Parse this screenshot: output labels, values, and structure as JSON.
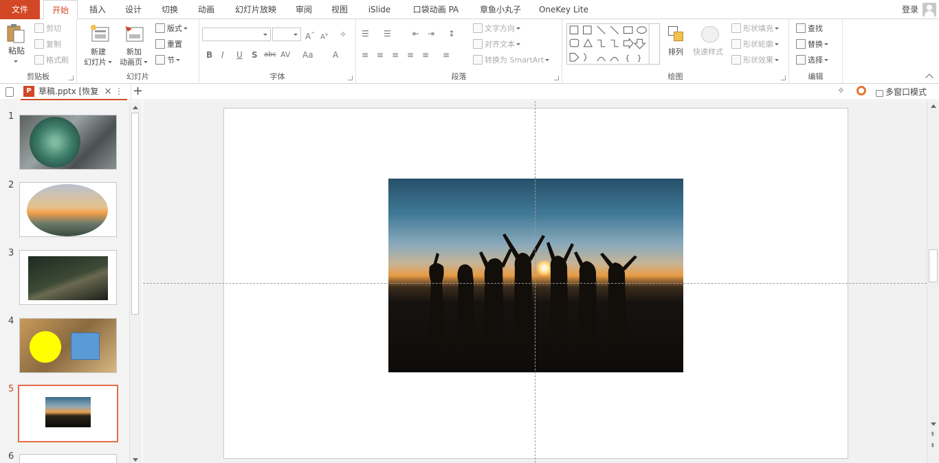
{
  "menu": {
    "file": "文件",
    "tabs": [
      "开始",
      "插入",
      "设计",
      "切换",
      "动画",
      "幻灯片放映",
      "审阅",
      "视图",
      "iSlide",
      "口袋动画 PA",
      "章鱼小丸子",
      "OneKey Lite"
    ],
    "login": "登录"
  },
  "ribbon": {
    "clipboard": {
      "label": "剪贴板",
      "paste": "粘贴",
      "cut": "剪切",
      "copy": "复制",
      "format_painter": "格式刷"
    },
    "slides": {
      "label": "幻灯片",
      "new_slide_1": "新建",
      "new_slide_2": "幻灯片",
      "new_anim_1": "新加",
      "new_anim_2": "动画页",
      "layout": "版式",
      "reset": "重置",
      "section": "节"
    },
    "font": {
      "label": "字体",
      "bold": "B",
      "italic": "I",
      "underline": "U",
      "shadow": "S",
      "strike": "abc",
      "spacing": "AV",
      "case": "Aa",
      "color": "A"
    },
    "paragraph": {
      "label": "段落",
      "text_direction": "文字方向",
      "align_text": "对齐文本",
      "smartart": "转换为 SmartArt"
    },
    "drawing": {
      "label": "绘图",
      "arrange": "排列",
      "quick_styles": "快速样式",
      "shape_fill": "形状填充",
      "shape_outline": "形状轮廓",
      "shape_effects": "形状效果"
    },
    "editing": {
      "label": "编辑",
      "find": "查找",
      "replace": "替换",
      "select": "选择"
    }
  },
  "tabstrip": {
    "doc_title": "草稿.pptx [恢复",
    "multi_window": "多窗口模式",
    "add": "+"
  },
  "thumbs": {
    "numbers": [
      "1",
      "2",
      "3",
      "4",
      "5",
      "6"
    ],
    "selected": "5"
  },
  "colors": {
    "accent": "#d24726",
    "selected_border": "#e46c4a"
  }
}
